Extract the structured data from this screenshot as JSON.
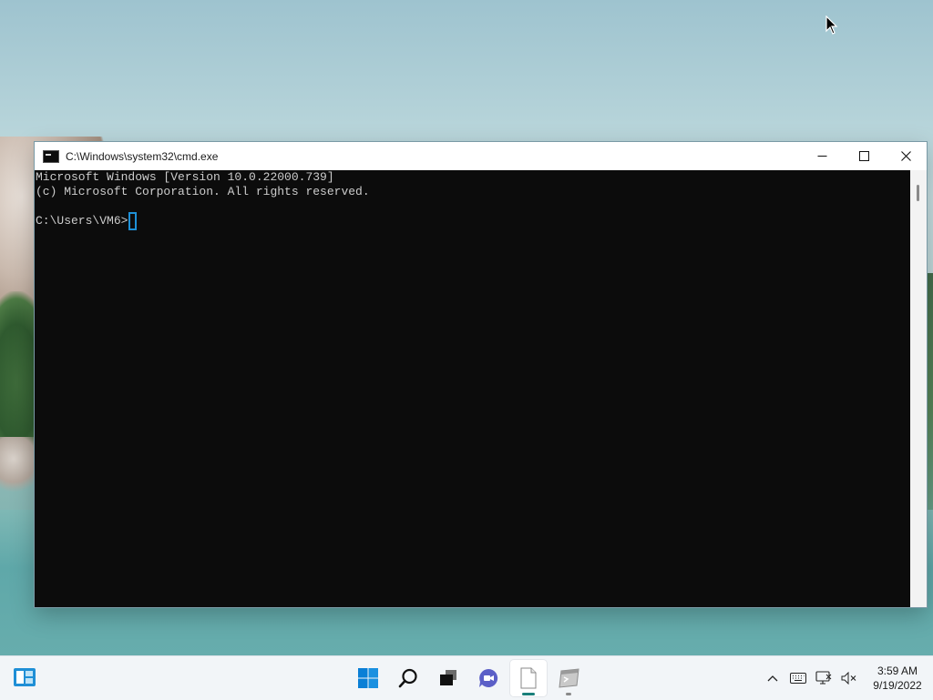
{
  "window": {
    "title": "C:\\Windows\\system32\\cmd.exe",
    "controls": {
      "minimize": "minimize-icon",
      "maximize": "maximize-icon",
      "close": "close-icon"
    }
  },
  "console": {
    "lines": [
      "Microsoft Windows [Version 10.0.22000.739]",
      "(c) Microsoft Corporation. All rights reserved.",
      "",
      "C:\\Users\\VM6>"
    ]
  },
  "taskbar": {
    "widgets_icon": "widgets-icon",
    "pinned": [
      {
        "name": "start-button",
        "icon": "windows-logo-icon",
        "state": "normal"
      },
      {
        "name": "search-button",
        "icon": "search-icon",
        "state": "normal"
      },
      {
        "name": "task-view-button",
        "icon": "task-view-icon",
        "state": "normal"
      },
      {
        "name": "chat-button",
        "icon": "chat-icon",
        "state": "normal"
      },
      {
        "name": "file-app-button",
        "icon": "document-icon",
        "state": "active"
      },
      {
        "name": "cmd-app-button",
        "icon": "terminal-icon",
        "state": "open"
      }
    ],
    "tray": {
      "icons": [
        "chevron-up-icon",
        "keyboard-icon",
        "network-icon",
        "volume-muted-icon"
      ],
      "time": "3:59 AM",
      "date": "9/19/2022"
    }
  },
  "colors": {
    "console_bg": "#0c0c0c",
    "console_text": "#cccccc",
    "caret": "#1e90d6",
    "titlebar_bg": "#ffffff",
    "taskbar_bg": "#f2f5f8",
    "accent": "#0078d4"
  }
}
